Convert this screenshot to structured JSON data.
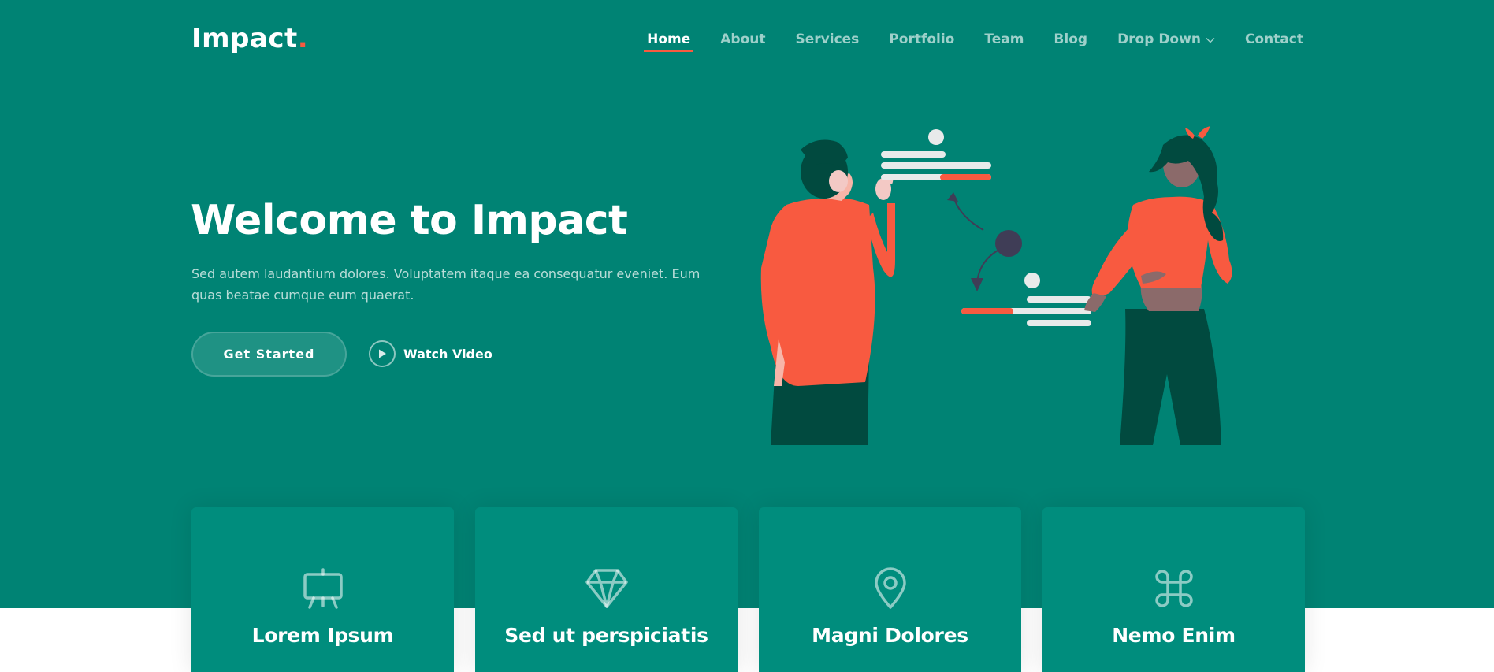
{
  "header": {
    "logo_text": "Impact",
    "logo_dot": ".",
    "nav": [
      {
        "label": "Home",
        "active": true
      },
      {
        "label": "About"
      },
      {
        "label": "Services"
      },
      {
        "label": "Portfolio"
      },
      {
        "label": "Team"
      },
      {
        "label": "Blog"
      },
      {
        "label": "Drop Down"
      },
      {
        "label": "Contact"
      }
    ]
  },
  "hero": {
    "title": "Welcome to Impact",
    "text": "Sed autem laudantium dolores. Voluptatem itaque ea consequatur eveniet. Eum quas beatae cumque eum quaerat.",
    "cta_label": "Get Started",
    "video_label": "Watch Video"
  },
  "cards": [
    {
      "title": "Lorem Ipsum",
      "icon": "easel-icon"
    },
    {
      "title": "Sed ut perspiciatis",
      "icon": "gem-icon"
    },
    {
      "title": "Magni Dolores",
      "icon": "map-pin-icon"
    },
    {
      "title": "Nemo Enim",
      "icon": "command-icon"
    }
  ],
  "colors": {
    "primary": "#008374",
    "card": "#008d7d",
    "accent": "#f85a40",
    "white": "#ffffff"
  }
}
